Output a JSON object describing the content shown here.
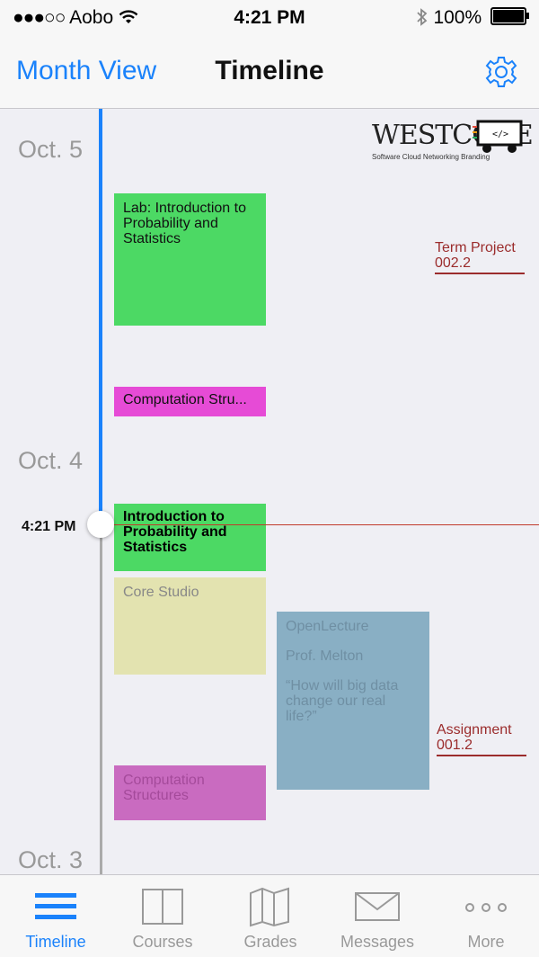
{
  "status_bar": {
    "signal": "●●●○○",
    "carrier": "Aobo",
    "time": "4:21 PM",
    "battery": "100%"
  },
  "nav": {
    "left_label": "Month View",
    "title": "Timeline",
    "settings_icon": "gear-icon"
  },
  "logo": {
    "word": "WESTCODE",
    "tags": "Software  Cloud  Networking  Branding"
  },
  "timeline": {
    "dates": [
      "Oct. 5",
      "Oct. 4",
      "Oct. 3"
    ],
    "now_label": "4:21 PM",
    "events": [
      {
        "title": "Lab: Introduction to Probability and Statistics",
        "color": "#4cd964"
      },
      {
        "title": "Computation Stru...",
        "color": "#e64bd6"
      },
      {
        "title": "Introduction to Probability and Statistics",
        "color": "#4cd964"
      },
      {
        "title": "Core Studio",
        "color": "#e3e3b0"
      },
      {
        "title": "Computation Structures",
        "color": "#c96bc0"
      },
      {
        "line1": "OpenLecture",
        "line2": "Prof. Melton",
        "line3": "“How will big data change our real life?”",
        "color": "#89afc4"
      }
    ],
    "deadlines": [
      {
        "line1": "Term Project",
        "line2": "002.2"
      },
      {
        "line1": "Assignment",
        "line2": "001.2"
      }
    ]
  },
  "tabs": [
    {
      "label": "Timeline",
      "icon": "list-icon",
      "active": true
    },
    {
      "label": "Courses",
      "icon": "book-icon",
      "active": false
    },
    {
      "label": "Grades",
      "icon": "map-icon",
      "active": false
    },
    {
      "label": "Messages",
      "icon": "envelope-icon",
      "active": false
    },
    {
      "label": "More",
      "icon": "more-dots-icon",
      "active": false
    }
  ],
  "colors": {
    "accent": "#1a82fb",
    "deadline": "#9b2c2c",
    "now_line": "#c0392b"
  }
}
